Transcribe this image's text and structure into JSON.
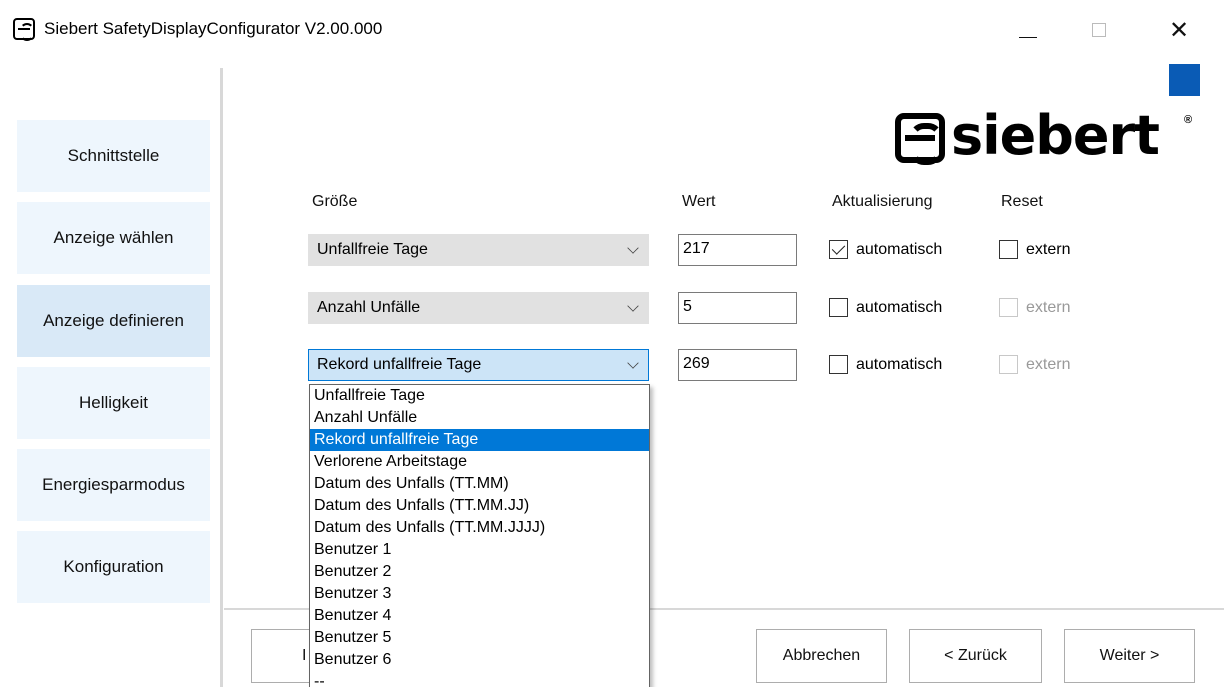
{
  "window": {
    "title": "Siebert SafetyDisplayConfigurator V2.00.000",
    "close_glyph": "✕"
  },
  "sidebar": {
    "items": [
      {
        "label": "Schnittstelle"
      },
      {
        "label": "Anzeige wählen"
      },
      {
        "label": "Anzeige definieren",
        "active": true
      },
      {
        "label": "Helligkeit"
      },
      {
        "label": "Energiesparmodus"
      },
      {
        "label": "Konfiguration"
      }
    ]
  },
  "logo": {
    "text": "siebert",
    "reg": "®"
  },
  "colors": {
    "accent": "#0a5bb5",
    "selection": "#0078d7",
    "nav_bg": "#eef6fd"
  },
  "columns": {
    "groesse": "Größe",
    "wert": "Wert",
    "aktualisierung": "Aktualisierung",
    "reset": "Reset"
  },
  "rows": [
    {
      "groesse": "Unfallfreie Tage",
      "wert": "217",
      "auto_label": "automatisch",
      "auto_checked": true,
      "reset_label": "extern",
      "reset_enabled": true
    },
    {
      "groesse": "Anzahl Unfälle",
      "wert": "5",
      "auto_label": "automatisch",
      "auto_checked": false,
      "reset_label": "extern",
      "reset_enabled": false
    },
    {
      "groesse": "Rekord unfallfreie Tage",
      "wert": "269",
      "auto_label": "automatisch",
      "auto_checked": false,
      "reset_label": "extern",
      "reset_enabled": false
    }
  ],
  "dropdown": {
    "options": [
      "Unfallfreie Tage",
      "Anzahl Unfälle",
      "Rekord unfallfreie Tage",
      "Verlorene Arbeitstage",
      "Datum des Unfalls (TT.MM)",
      "Datum des Unfalls (TT.MM.JJ)",
      "Datum des Unfalls (TT.MM.JJJJ)",
      "Benutzer 1",
      "Benutzer 2",
      "Benutzer 3",
      "Benutzer 4",
      "Benutzer 5",
      "Benutzer 6",
      "--"
    ],
    "selected_index": 2
  },
  "buttons": {
    "hidden_partial": "I",
    "abbrechen": "Abbrechen",
    "zurueck": "< Zurück",
    "weiter": "Weiter >"
  }
}
